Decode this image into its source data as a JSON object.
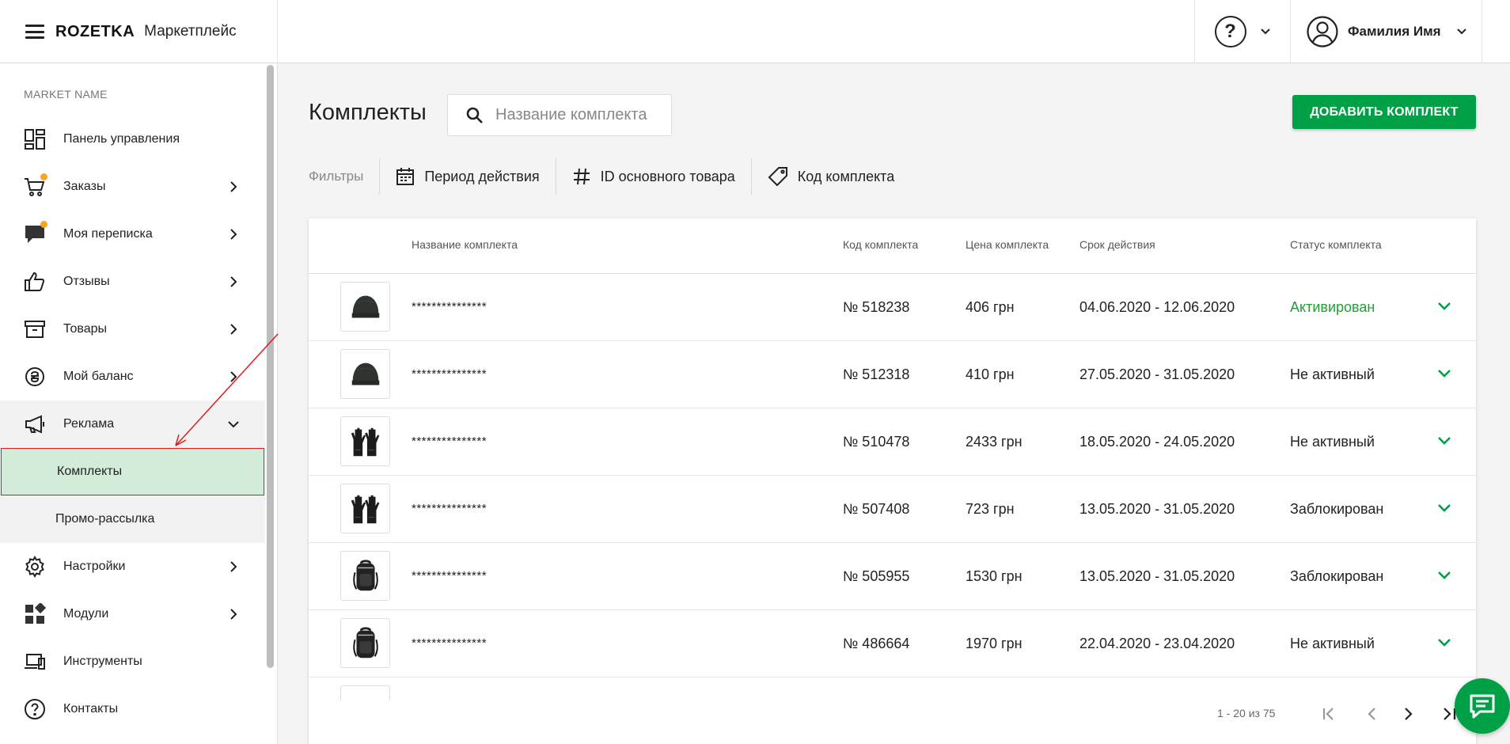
{
  "header": {
    "logo": "ROZETKA",
    "marketplace": "Маркетплейс",
    "help_symbol": "?",
    "user_name": "Фамилия Имя"
  },
  "sidebar": {
    "market_name": "MARKET NAME",
    "items": [
      {
        "label": "Панель управления",
        "icon": "dashboard-icon"
      },
      {
        "label": "Заказы",
        "icon": "cart-icon"
      },
      {
        "label": "Моя переписка",
        "icon": "chat-bubble-icon"
      },
      {
        "label": "Отзывы",
        "icon": "thumbs-up-icon"
      },
      {
        "label": "Товары",
        "icon": "box-icon"
      },
      {
        "label": "Мой баланс",
        "icon": "balance-icon"
      },
      {
        "label": "Реклама",
        "icon": "megaphone-icon"
      },
      {
        "label": "Настройки",
        "icon": "gear-icon"
      },
      {
        "label": "Модули",
        "icon": "modules-icon"
      },
      {
        "label": "Инструменты",
        "icon": "devices-icon"
      },
      {
        "label": "Контакты",
        "icon": "help-circle-icon"
      }
    ],
    "sub_items": [
      {
        "label": "Комплекты"
      },
      {
        "label": "Промо-рассылка"
      }
    ]
  },
  "main": {
    "title": "Комплекты",
    "search_placeholder": "Название комплекта",
    "add_button": "ДОБАВИТЬ КОМПЛЕКТ",
    "filters": {
      "label": "Фильтры",
      "period": "Период действия",
      "main_id": "ID основного товара",
      "kit_code": "Код комплекта"
    },
    "table": {
      "headers": {
        "name": "Название комплекта",
        "code": "Код комплекта",
        "price": "Цена комплекта",
        "period": "Срок действия",
        "status": "Статус комплекта"
      },
      "rows": [
        {
          "name": "***************",
          "code": "№ 518238",
          "price": "406 грн",
          "period": "04.06.2020 - 12.06.2020",
          "status": "Активирован",
          "thumb": "hat"
        },
        {
          "name": "***************",
          "code": "№ 512318",
          "price": "410 грн",
          "period": "27.05.2020 - 31.05.2020",
          "status": "Не активный",
          "thumb": "hat"
        },
        {
          "name": "***************",
          "code": "№ 510478",
          "price": "2433 грн",
          "period": "18.05.2020 - 24.05.2020",
          "status": "Не активный",
          "thumb": "gloves"
        },
        {
          "name": "***************",
          "code": "№ 507408",
          "price": "723 грн",
          "period": "13.05.2020 - 31.05.2020",
          "status": "Заблокирован",
          "thumb": "gloves"
        },
        {
          "name": "***************",
          "code": "№ 505955",
          "price": "1530 грн",
          "period": "13.05.2020 - 31.05.2020",
          "status": "Заблокирован",
          "thumb": "backpack"
        },
        {
          "name": "***************",
          "code": "№ 486664",
          "price": "1970 грн",
          "period": "22.04.2020 - 23.04.2020",
          "status": "Не активный",
          "thumb": "backpack"
        }
      ]
    },
    "pagination": "1 - 20 из 75"
  },
  "colors": {
    "brand_green": "#00a046",
    "status_active": "#21a039",
    "active_sub_bg": "#d3ecd9",
    "annotation_red": "#e11b1b"
  }
}
